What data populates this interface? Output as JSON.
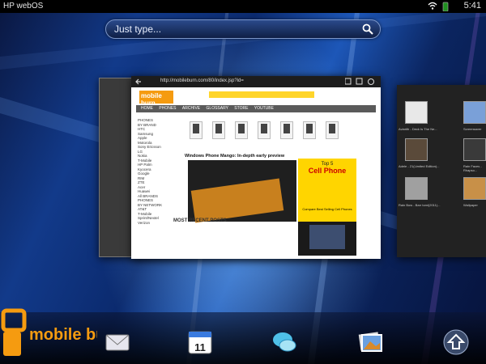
{
  "status_bar": {
    "brand": "HP webOS",
    "time": "5:41"
  },
  "search": {
    "placeholder": "Just type..."
  },
  "browser": {
    "url": "http://mobileburn.com/80/index.jsp?id=",
    "logo": "mobile burn",
    "nav": [
      "HOME",
      "PHONES",
      "ARCHIVE",
      "GLOSSARY",
      "STORE",
      "YOUTUBE"
    ],
    "sidebar": [
      "PHONES",
      "BY BRAND",
      "HTC",
      "Samsung",
      "Apple",
      "Motorola",
      "Sony Ericsson",
      "LG",
      "Nokia",
      "T-Mobile",
      "HP Palm",
      "Kyocera",
      "Google",
      "RIM",
      "ZTE",
      "Acer",
      "Huawei",
      "All BRANDS",
      "",
      "PHONES",
      "BY NETWORK",
      "AT&T",
      "T-Mobile",
      "Sprint/Nextel",
      "Verizon"
    ],
    "feature_title": "Windows Phone Mango: In-depth early preview",
    "recent": "MOST RECENT POSTS",
    "ad_top": "Top 5",
    "ad_headline": "Cell Phone",
    "ad_footer": "Compare Best Selling Cell Phones"
  },
  "side_card": {
    "items": [
      "Aviarith - Deck Is The Ne...",
      "Screensaver",
      "Adele - 21(Limited Edition)...",
      "Rain Faces - Rhapso...",
      "Rain Bow - Barr tomi(2011)...",
      "Wallpaper"
    ]
  },
  "dock": {
    "calendar_day": "11"
  },
  "watermark": "mobile burn",
  "colors": {
    "accent": "#1d57b8",
    "brand_orange": "#f59b10"
  }
}
